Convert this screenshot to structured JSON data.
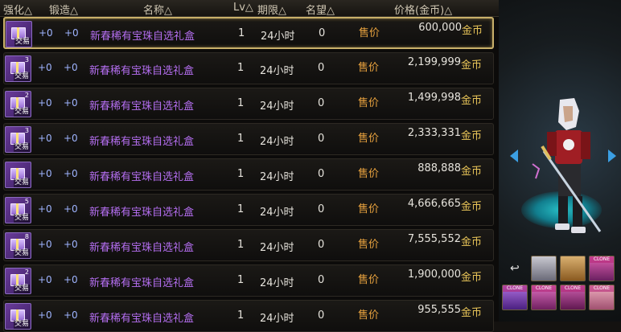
{
  "header": {
    "enhance": "强化△",
    "forge": "锻造△",
    "name": "名称△",
    "lv": "Lv△",
    "period": "期限△",
    "fame": "名望△",
    "price": "价格(金币)△"
  },
  "listings": [
    {
      "count": "",
      "trade": "交易",
      "enhance": "+0",
      "forge": "+0",
      "name": "新春稀有宝珠自选礼盒",
      "lv": "1",
      "period": "24小时",
      "fame": "0",
      "action": "售价",
      "price": "600,000",
      "currency": "金币"
    },
    {
      "count": "3",
      "trade": "交易",
      "enhance": "+0",
      "forge": "+0",
      "name": "新春稀有宝珠自选礼盒",
      "lv": "1",
      "period": "24小时",
      "fame": "0",
      "action": "售价",
      "price": "2,199,999",
      "currency": "金币"
    },
    {
      "count": "2",
      "trade": "交易",
      "enhance": "+0",
      "forge": "+0",
      "name": "新春稀有宝珠自选礼盒",
      "lv": "1",
      "period": "24小时",
      "fame": "0",
      "action": "售价",
      "price": "1,499,998",
      "currency": "金币"
    },
    {
      "count": "3",
      "trade": "交易",
      "enhance": "+0",
      "forge": "+0",
      "name": "新春稀有宝珠自选礼盒",
      "lv": "1",
      "period": "24小时",
      "fame": "0",
      "action": "售价",
      "price": "2,333,331",
      "currency": "金币"
    },
    {
      "count": "",
      "trade": "交易",
      "enhance": "+0",
      "forge": "+0",
      "name": "新春稀有宝珠自选礼盒",
      "lv": "1",
      "period": "24小时",
      "fame": "0",
      "action": "售价",
      "price": "888,888",
      "currency": "金币"
    },
    {
      "count": "5",
      "trade": "交易",
      "enhance": "+0",
      "forge": "+0",
      "name": "新春稀有宝珠自选礼盒",
      "lv": "1",
      "period": "24小时",
      "fame": "0",
      "action": "售价",
      "price": "4,666,665",
      "currency": "金币"
    },
    {
      "count": "8",
      "trade": "交易",
      "enhance": "+0",
      "forge": "+0",
      "name": "新春稀有宝珠自选礼盒",
      "lv": "1",
      "period": "24小时",
      "fame": "0",
      "action": "售价",
      "price": "7,555,552",
      "currency": "金币"
    },
    {
      "count": "2",
      "trade": "交易",
      "enhance": "+0",
      "forge": "+0",
      "name": "新春稀有宝珠自选礼盒",
      "lv": "1",
      "period": "24小时",
      "fame": "0",
      "action": "售价",
      "price": "1,900,000",
      "currency": "金币"
    },
    {
      "count": "",
      "trade": "交易",
      "enhance": "+0",
      "forge": "+0",
      "name": "新春稀有宝珠自选礼盒",
      "lv": "1",
      "period": "24小时",
      "fame": "0",
      "action": "售价",
      "price": "955,555",
      "currency": "金币"
    }
  ],
  "right_panel": {
    "slot_label": "CLONE",
    "icons": [
      "undo-icon",
      "arrow-left-icon",
      "arrow-right-icon"
    ]
  },
  "colors": {
    "name": "#b46ef0",
    "sell": "#e8a23e",
    "gold": "#e8c458",
    "selected_border": "#c9b06a"
  }
}
